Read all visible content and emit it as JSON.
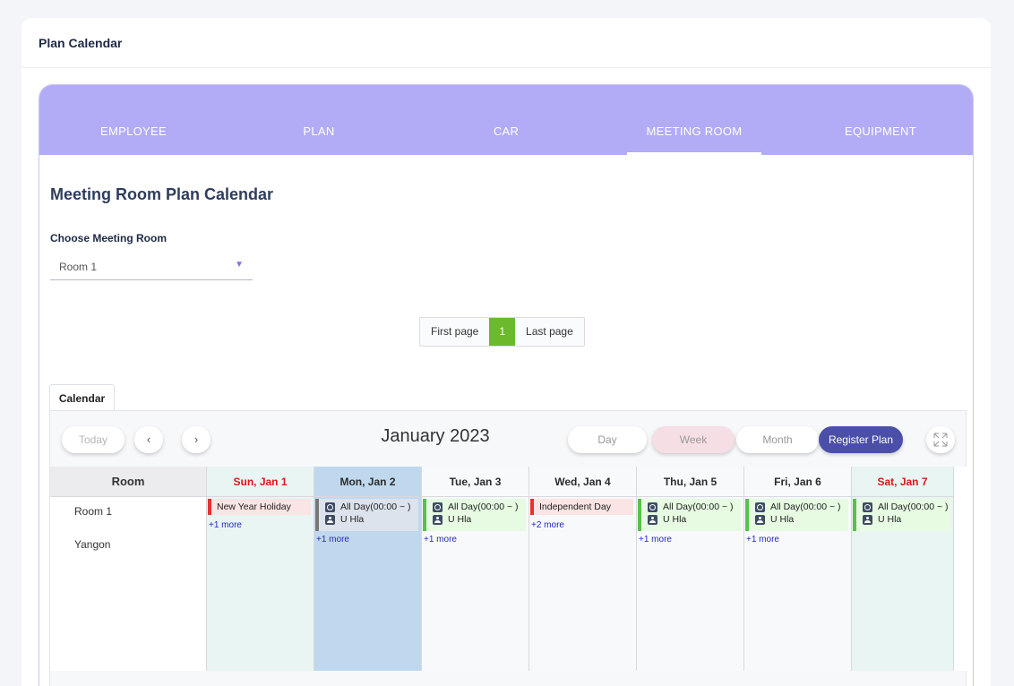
{
  "page": {
    "title": "Plan Calendar"
  },
  "tabs": [
    {
      "label": "EMPLOYEE"
    },
    {
      "label": "PLAN"
    },
    {
      "label": "CAR"
    },
    {
      "label": "MEETING ROOM"
    },
    {
      "label": "EQUIPMENT"
    }
  ],
  "active_tab": "MEETING ROOM",
  "section": {
    "title": "Meeting Room Plan Calendar",
    "choose_label": "Choose Meeting Room",
    "room_value": "Room 1"
  },
  "pagination": {
    "first": "First page",
    "current": "1",
    "last": "Last page"
  },
  "calendar": {
    "tab_label": "Calendar",
    "today": "Today",
    "prev": "‹",
    "next": "›",
    "title": "January 2023",
    "views": {
      "day": "Day",
      "week": "Week",
      "month": "Month"
    },
    "active_view": "Week",
    "register": "Register Plan",
    "room_header": "Room",
    "rooms": [
      "Room 1",
      "Yangon"
    ],
    "days": [
      {
        "label": "Sun, Jan 1",
        "kind": "sun",
        "bg": "#e8f5f2",
        "event": {
          "type": "holiday",
          "title": "New Year Holiday"
        },
        "more": "+1 more"
      },
      {
        "label": "Mon, Jan 2",
        "kind": "today",
        "bg": "#bfd8ee",
        "event": {
          "type": "plan",
          "style": "grey",
          "time": "All Day(00:00 ~ )",
          "user": "U Hla"
        },
        "more": "+1 more"
      },
      {
        "label": "Tue, Jan 3",
        "kind": "weekday",
        "bg": "#f8f9fb",
        "event": {
          "type": "plan",
          "style": "green",
          "time": "All Day(00:00 ~ )",
          "user": "U Hla"
        },
        "more": "+1 more"
      },
      {
        "label": "Wed, Jan 4",
        "kind": "weekday",
        "bg": "#f8f9fb",
        "event": {
          "type": "holiday",
          "title": "Independent Day"
        },
        "more": "+2 more"
      },
      {
        "label": "Thu, Jan 5",
        "kind": "weekday",
        "bg": "#f8f9fb",
        "event": {
          "type": "plan",
          "style": "green",
          "time": "All Day(00:00 ~ )",
          "user": "U Hla"
        },
        "more": "+1 more"
      },
      {
        "label": "Fri, Jan 6",
        "kind": "weekday",
        "bg": "#f8f9fb",
        "event": {
          "type": "plan",
          "style": "green",
          "time": "All Day(00:00 ~ )",
          "user": "U Hla"
        },
        "more": "+1 more"
      },
      {
        "label": "Sat, Jan 7",
        "kind": "sat",
        "bg": "#e8f5f2",
        "event": {
          "type": "plan",
          "style": "green",
          "time": "All Day(00:00 ~ )",
          "user": "U Hla"
        },
        "more": ""
      }
    ]
  },
  "colors": {
    "accent": "#b2acf6",
    "register_button": "#4b4fa8",
    "week_active": "#f6dee5",
    "pager_active": "#6cba2b",
    "weekend_text": "#e0151b"
  }
}
